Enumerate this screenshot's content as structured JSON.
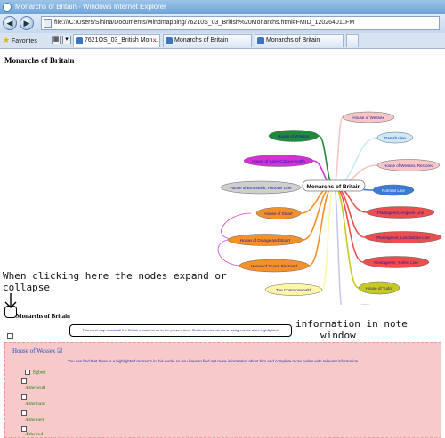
{
  "window": {
    "title": "Monarchs of Britain - Windows Internet Explorer"
  },
  "address": {
    "url": "file:///C:/Users/Sihina/Documents/Mindmapping/76210S_03_British%20Monarchs.html#FMID_120264011FM"
  },
  "toolbar": {
    "favorites_label": "Favorites",
    "tabs": [
      {
        "label": "7621OS_03_British Mon...",
        "active": true
      },
      {
        "label": "Monarchs of Britain",
        "active": false
      },
      {
        "label": "Monarchs of Britain",
        "active": false
      }
    ]
  },
  "page": {
    "title": "Monarchs of Britain"
  },
  "mindmap": {
    "center": "Monarchs of Britain",
    "nodes": [
      {
        "label": "House of Wessex",
        "color": "#f7c6c6"
      },
      {
        "label": "Danish Line",
        "color": "#cbe9f7"
      },
      {
        "label": "House of Wessex, Restored",
        "color": "#f7c6c6"
      },
      {
        "label": "Norman Line",
        "color": "#3b7bd8"
      },
      {
        "label": "Plantagenet, Angevin Line",
        "color": "#ee4d4d"
      },
      {
        "label": "Plantagenet, Lancastrian Line",
        "color": "#ee4d4d"
      },
      {
        "label": "Plantagenet, Yorkist Line",
        "color": "#ee4d4d"
      },
      {
        "label": "House of Tudor",
        "color": "#c8c822"
      },
      {
        "label": "House of Stuart",
        "color": "#c8c8e8"
      },
      {
        "label": "The Commonwealth",
        "color": "#fff6a8"
      },
      {
        "label": "House of Stuart, Restored",
        "color": "#f4902a"
      },
      {
        "label": "House of Orange and Stuart",
        "color": "#f4902a"
      },
      {
        "label": "House of Stuart",
        "color": "#f4902a"
      },
      {
        "label": "House of Brunswick, Hanover Line",
        "color": "#cfcfcf"
      },
      {
        "label": "House of Saxe-Coburg-Gotha",
        "color": "#d830d8"
      },
      {
        "label": "House of Windsor",
        "color": "#1f8a3a"
      }
    ]
  },
  "annotations": {
    "expand_line1": "When clicking here the nodes expand or",
    "expand_line2": "collapse",
    "note_line1": "information in note",
    "note_line2": "window"
  },
  "sub_map_title": "Monarchs of Britain",
  "note_text": "This mind map shows all the British monarchs up to the present time. Students must do some assignments when highlighted.",
  "note_window": {
    "heading": "House of Wessex",
    "instruction": "You can find that there is a highlighted monarch in this node, so you have to find out more information about him and complete more nodes with relevant information.",
    "items": [
      "Egbert",
      "Æthelwulf",
      "Æthelbald",
      "Æthelbert",
      "Æthelred"
    ]
  }
}
